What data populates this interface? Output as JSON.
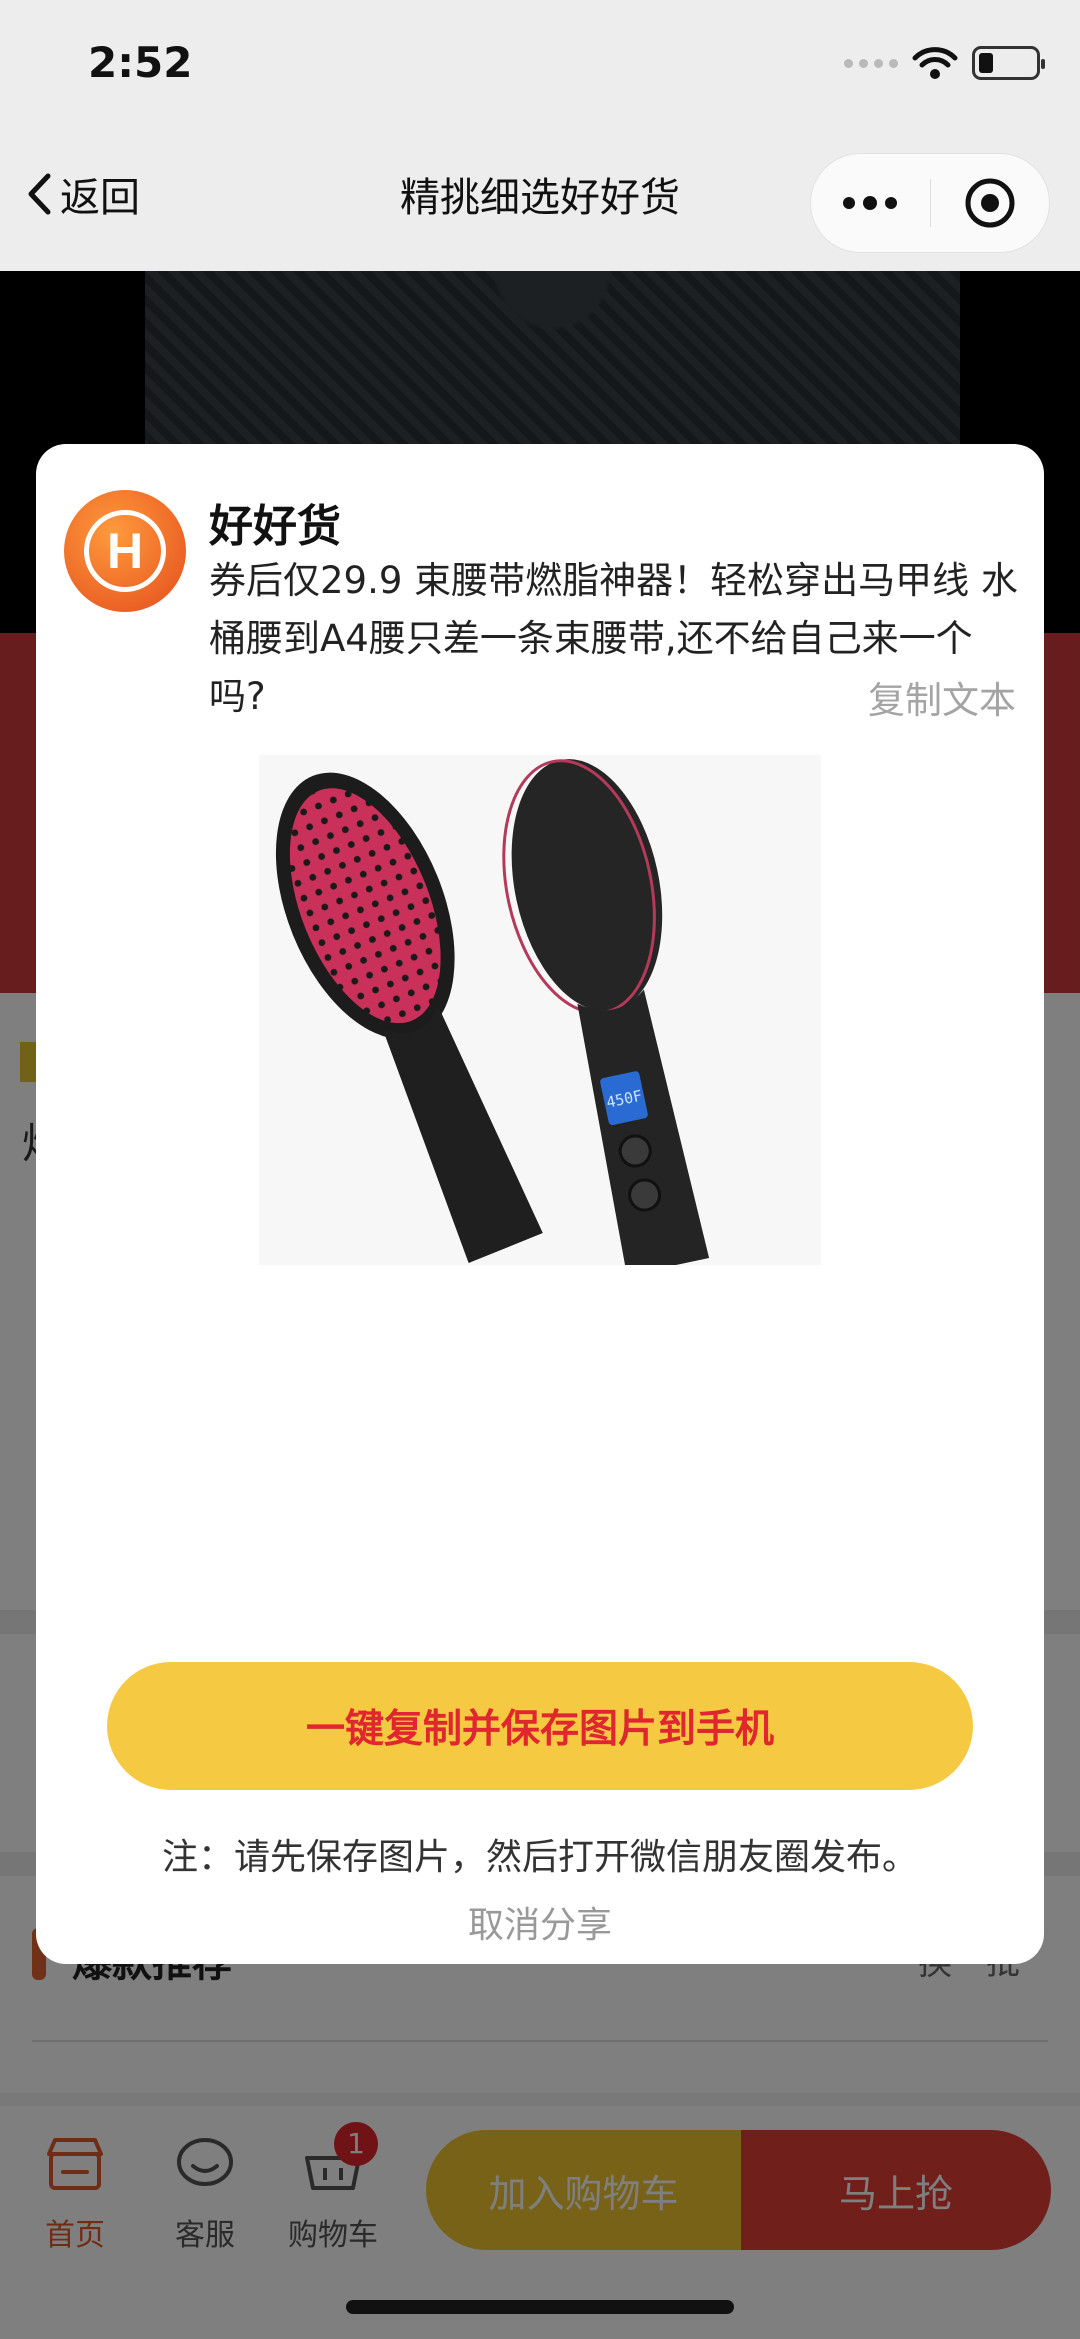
{
  "status_bar": {
    "time": "2:52",
    "battery_level": 0.26
  },
  "nav": {
    "back_label": "返回",
    "title": "精挑细选好好货"
  },
  "background_page": {
    "partial_glyph": "炒",
    "row_title": "爆款推荐",
    "row_right": "换一批"
  },
  "tab_bar": {
    "home_label": "首页",
    "service_label": "客服",
    "cart_label": "购物车",
    "cart_badge": "1",
    "add_to_cart_label": "加入购物车",
    "buy_now_label": "马上抢"
  },
  "share_modal": {
    "logo_letter": "H",
    "brand_name": "好好货",
    "share_text": "券后仅29.9 束腰带燃脂神器！轻松穿出马甲线 水桶腰到A4腰只差一条束腰带,还不给自己来一个吗?",
    "copy_label": "复制文本",
    "product_image_icon": "hair-straightening-brush",
    "display_reading": "450F",
    "save_button_label": "一键复制并保存图片到手机",
    "note": "注：请先保存图片，然后打开微信朋友圈发布。",
    "cancel_label": "取消分享"
  },
  "colors": {
    "accent_red": "#e0262e",
    "button_yellow": "#f6c942",
    "brand_orange": "#e34c1c"
  }
}
